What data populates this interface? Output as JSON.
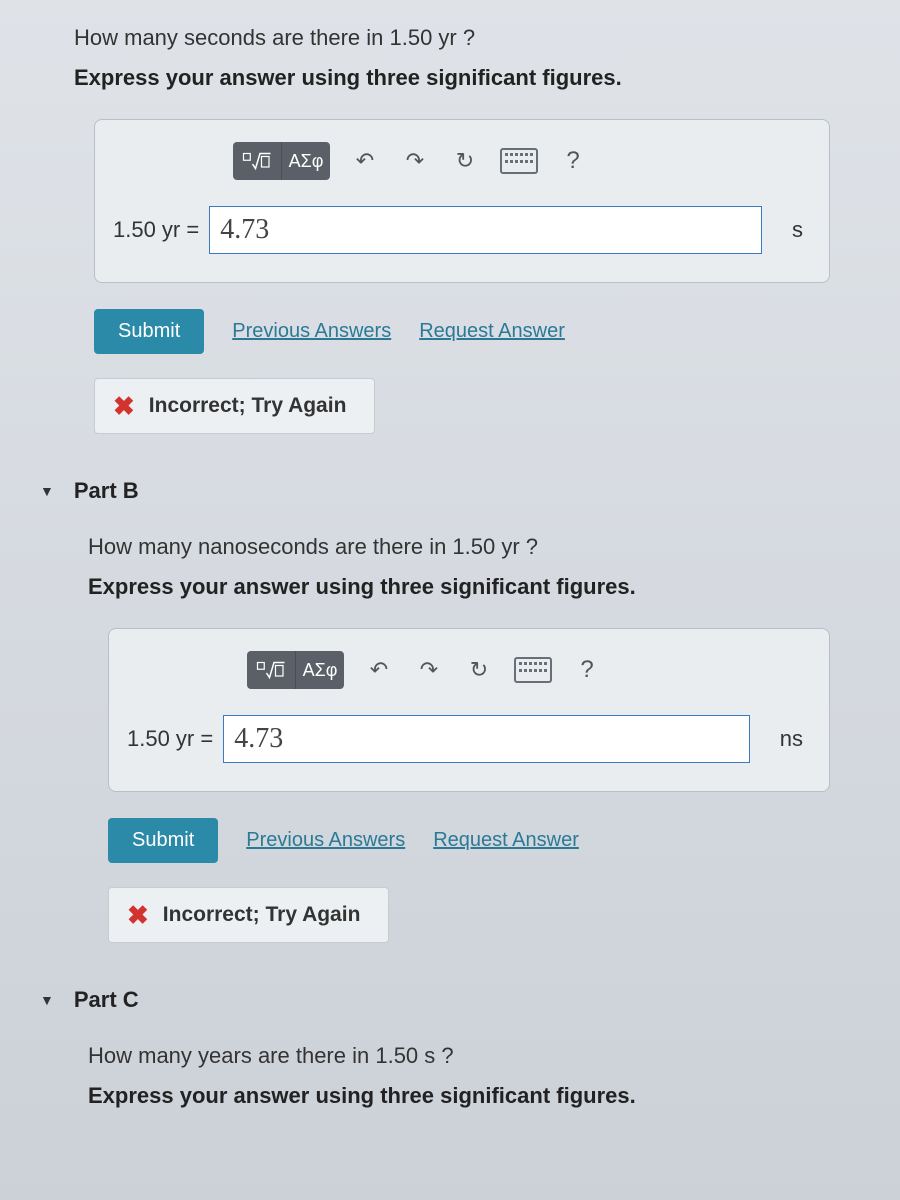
{
  "partA": {
    "question": "How many seconds are there in 1.50  yr ?",
    "instruction": "Express your answer using three significant figures.",
    "toolbar": {
      "templates_label": "",
      "symbols_label": "ΑΣφ"
    },
    "equation_label": "1.50  yr =",
    "answer_value": "4.73",
    "unit": "s",
    "submit_label": "Submit",
    "previous_answers": "Previous Answers",
    "request_answer": "Request Answer",
    "feedback": "Incorrect; Try Again"
  },
  "partB": {
    "title": "Part B",
    "question": "How many nanoseconds are there in 1.50  yr ?",
    "instruction": "Express your answer using three significant figures.",
    "toolbar": {
      "symbols_label": "ΑΣφ"
    },
    "equation_label": "1.50  yr =",
    "answer_value": "4.73",
    "unit": "ns",
    "submit_label": "Submit",
    "previous_answers": "Previous Answers",
    "request_answer": "Request Answer",
    "feedback": "Incorrect; Try Again"
  },
  "partC": {
    "title": "Part C",
    "question": "How many years are there in 1.50  s ?",
    "instruction": "Express your answer using three significant figures."
  }
}
